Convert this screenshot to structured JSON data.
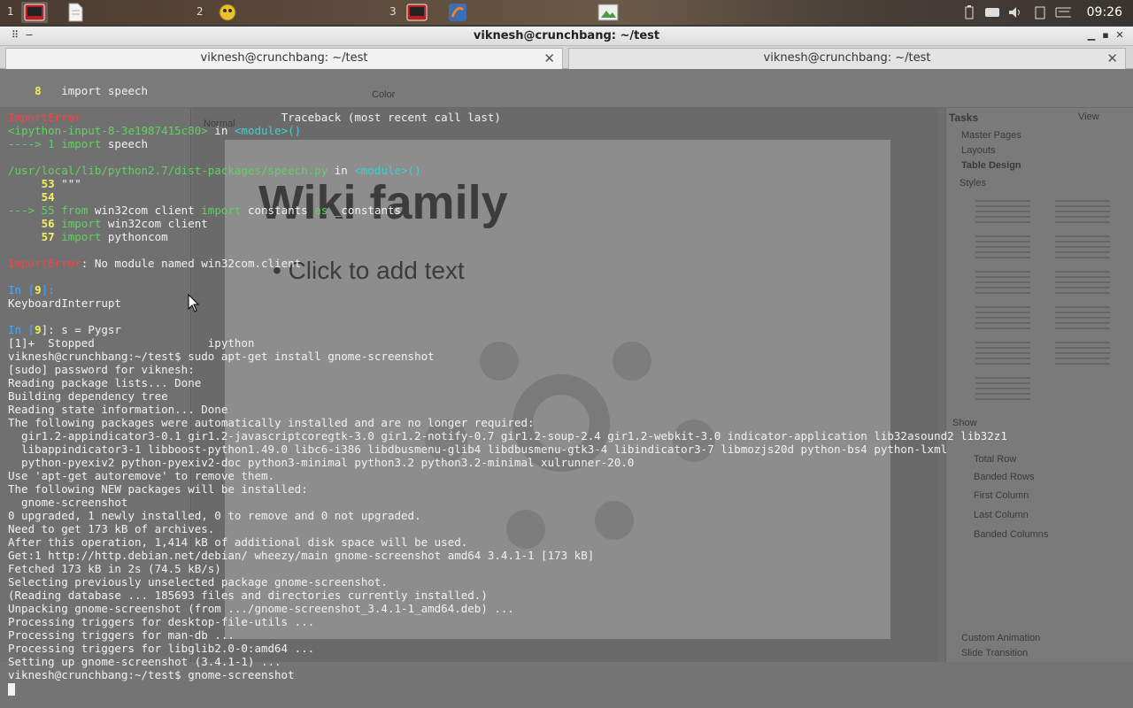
{
  "panel": {
    "workspaces": [
      "1",
      "2",
      "3"
    ],
    "clock": "09:26"
  },
  "window": {
    "title": "viknesh@crunchbang: ~/test"
  },
  "tabs": [
    {
      "label": "viknesh@crunchbang: ~/test"
    },
    {
      "label": "viknesh@crunchbang: ~/test"
    }
  ],
  "background_app": {
    "slide_title": "Wiki family",
    "slide_placeholder": "• Click to add text",
    "view_tab": "Normal",
    "color_dropdown": "Color",
    "tasks_title": "Tasks",
    "tasks_view": "View",
    "task_sections": [
      "Master Pages",
      "Layouts",
      "Table Design"
    ],
    "styles_label": "Styles",
    "show_label": "Show",
    "show_options": [
      "Total Row",
      "Banded Rows",
      "First Column",
      "Last Column",
      "Banded Columns"
    ],
    "bottom_sections": [
      "Custom Animation",
      "Slide Transition"
    ]
  },
  "terminal": {
    "lines": [
      [
        {
          "t": "    ",
          "c": ""
        },
        {
          "t": "8",
          "c": "yellow"
        },
        {
          "t": "   import speech",
          "c": ""
        }
      ],
      [
        {
          "t": "",
          "c": ""
        }
      ],
      [
        {
          "t": "ImportError",
          "c": "red"
        },
        {
          "t": "                              Traceback (most recent call last)",
          "c": ""
        }
      ],
      [
        {
          "t": "<ipython-input-8-3e1987415c80>",
          "c": "green"
        },
        {
          "t": " in ",
          "c": ""
        },
        {
          "t": "<module>()",
          "c": "cyan"
        }
      ],
      [
        {
          "t": "----> 1 ",
          "c": "green"
        },
        {
          "t": "import",
          "c": "green"
        },
        {
          "t": " speech",
          "c": ""
        }
      ],
      [
        {
          "t": "",
          "c": ""
        }
      ],
      [
        {
          "t": "/usr/local/lib/python2.7/dist-packages/speech.py",
          "c": "green"
        },
        {
          "t": " in ",
          "c": ""
        },
        {
          "t": "<module>()",
          "c": "cyan"
        }
      ],
      [
        {
          "t": "     ",
          "c": ""
        },
        {
          "t": "53",
          "c": "yellow"
        },
        {
          "t": " \"\"\"",
          "c": ""
        }
      ],
      [
        {
          "t": "     ",
          "c": ""
        },
        {
          "t": "54",
          "c": "yellow"
        }
      ],
      [
        {
          "t": "---> 55 ",
          "c": "green"
        },
        {
          "t": "from",
          "c": "green"
        },
        {
          "t": " win32com client ",
          "c": ""
        },
        {
          "t": "import",
          "c": "green"
        },
        {
          "t": " constants ",
          "c": ""
        },
        {
          "t": "as",
          "c": "green"
        },
        {
          "t": " _constants",
          "c": ""
        }
      ],
      [
        {
          "t": "     ",
          "c": ""
        },
        {
          "t": "56",
          "c": "yellow"
        },
        {
          "t": " ",
          "c": ""
        },
        {
          "t": "import",
          "c": "green"
        },
        {
          "t": " win32com client",
          "c": ""
        }
      ],
      [
        {
          "t": "     ",
          "c": ""
        },
        {
          "t": "57",
          "c": "yellow"
        },
        {
          "t": " ",
          "c": ""
        },
        {
          "t": "import",
          "c": "green"
        },
        {
          "t": " pythoncom",
          "c": ""
        }
      ],
      [
        {
          "t": "",
          "c": ""
        }
      ],
      [
        {
          "t": "ImportError",
          "c": "red"
        },
        {
          "t": ": No module named win32com.client",
          "c": ""
        }
      ],
      [
        {
          "t": "",
          "c": ""
        }
      ],
      [
        {
          "t": "In [",
          "c": "blue"
        },
        {
          "t": "9",
          "c": "yellow"
        },
        {
          "t": "]: ",
          "c": "blue"
        }
      ],
      [
        {
          "t": "KeyboardInterrupt",
          "c": ""
        }
      ],
      [
        {
          "t": "",
          "c": ""
        }
      ],
      [
        {
          "t": "In [",
          "c": "blue"
        },
        {
          "t": "9",
          "c": "yellow"
        },
        {
          "t": "]: s = Pygsr",
          "c": ""
        }
      ],
      [
        {
          "t": "[1]+  Stopped                 ipython",
          "c": ""
        }
      ],
      [
        {
          "t": "viknesh@crunchbang:~/test$ sudo apt-get install gnome-screenshot",
          "c": ""
        }
      ],
      [
        {
          "t": "[sudo] password for viknesh:",
          "c": ""
        }
      ],
      [
        {
          "t": "Reading package lists... Done",
          "c": ""
        }
      ],
      [
        {
          "t": "Building dependency tree",
          "c": ""
        }
      ],
      [
        {
          "t": "Reading state information... Done",
          "c": ""
        }
      ],
      [
        {
          "t": "The following packages were automatically installed and are no longer required:",
          "c": ""
        }
      ],
      [
        {
          "t": "  gir1.2-appindicator3-0.1 gir1.2-javascriptcoregtk-3.0 gir1.2-notify-0.7 gir1.2-soup-2.4 gir1.2-webkit-3.0 indicator-application lib32asound2 lib32z1",
          "c": ""
        }
      ],
      [
        {
          "t": "  libappindicator3-1 libboost-python1.49.0 libc6-i386 libdbusmenu-glib4 libdbusmenu-gtk3-4 libindicator3-7 libmozjs20d python-bs4 python-lxml",
          "c": ""
        }
      ],
      [
        {
          "t": "  python-pyexiv2 python-pyexiv2-doc python3-minimal python3.2 python3.2-minimal xulrunner-20.0",
          "c": ""
        }
      ],
      [
        {
          "t": "Use 'apt-get autoremove' to remove them.",
          "c": ""
        }
      ],
      [
        {
          "t": "The following NEW packages will be installed:",
          "c": ""
        }
      ],
      [
        {
          "t": "  gnome-screenshot",
          "c": ""
        }
      ],
      [
        {
          "t": "0 upgraded, 1 newly installed, 0 to remove and 0 not upgraded.",
          "c": ""
        }
      ],
      [
        {
          "t": "Need to get 173 kB of archives.",
          "c": ""
        }
      ],
      [
        {
          "t": "After this operation, 1,414 kB of additional disk space will be used.",
          "c": ""
        }
      ],
      [
        {
          "t": "Get:1 http://http.debian.net/debian/ wheezy/main gnome-screenshot amd64 3.4.1-1 [173 kB]",
          "c": ""
        }
      ],
      [
        {
          "t": "Fetched 173 kB in 2s (74.5 kB/s)",
          "c": ""
        }
      ],
      [
        {
          "t": "Selecting previously unselected package gnome-screenshot.",
          "c": ""
        }
      ],
      [
        {
          "t": "(Reading database ... 185693 files and directories currently installed.)",
          "c": ""
        }
      ],
      [
        {
          "t": "Unpacking gnome-screenshot (from .../gnome-screenshot_3.4.1-1_amd64.deb) ...",
          "c": ""
        }
      ],
      [
        {
          "t": "Processing triggers for desktop-file-utils ...",
          "c": ""
        }
      ],
      [
        {
          "t": "Processing triggers for man-db ...",
          "c": ""
        }
      ],
      [
        {
          "t": "Processing triggers for libglib2.0-0:amd64 ...",
          "c": ""
        }
      ],
      [
        {
          "t": "Setting up gnome-screenshot (3.4.1-1) ...",
          "c": ""
        }
      ],
      [
        {
          "t": "viknesh@crunchbang:~/test$ gnome-screenshot",
          "c": ""
        }
      ]
    ]
  },
  "colors": {
    "terminal_bg": "#6e6e6e",
    "prompt_green": "#5fd35f",
    "error_red": "#ff4040",
    "lineno_yellow": "#f0f060",
    "ipython_blue": "#4aa3ff"
  }
}
